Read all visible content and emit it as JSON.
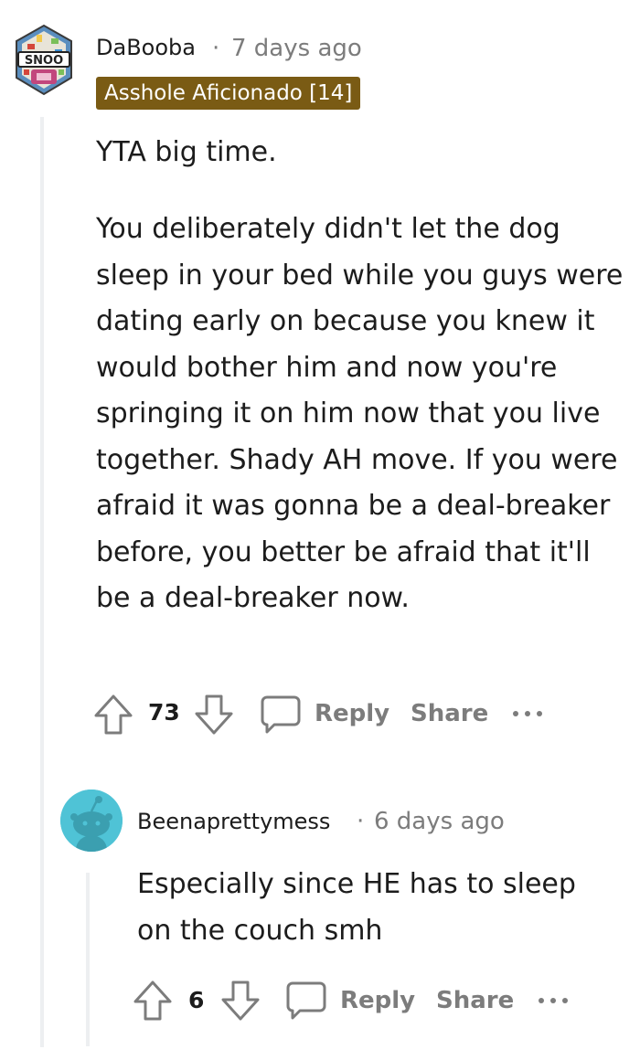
{
  "comment1": {
    "username": "DaBooba",
    "separator": "·",
    "time": "7 days ago",
    "flair": "Asshole Aficionado [14]",
    "flair_color": "#7a5b14",
    "avatar_text": "SNOO",
    "paragraph1": "YTA big time.",
    "paragraph2": "You deliberately didn't let the dog sleep in your bed while you guys were dating early on because you knew it would bother him and now you're springing it on him now that you live together. Shady AH move. If you were afraid it was gonna be a deal-breaker before, you better be afraid that it'll be a deal-breaker now.",
    "votes": "73",
    "reply_label": "Reply",
    "share_label": "Share"
  },
  "comment2": {
    "username": "Beenaprettymess",
    "separator": "·",
    "time": "6 days ago",
    "avatar_color": "#4fc3d6",
    "body": "Especially since HE has to sleep on the couch smh",
    "votes": "6",
    "reply_label": "Reply",
    "share_label": "Share"
  },
  "icons": {
    "upvote": "upvote-arrow-icon",
    "downvote": "downvote-arrow-icon",
    "reply": "speech-bubble-icon",
    "more": "more-options-icon"
  }
}
